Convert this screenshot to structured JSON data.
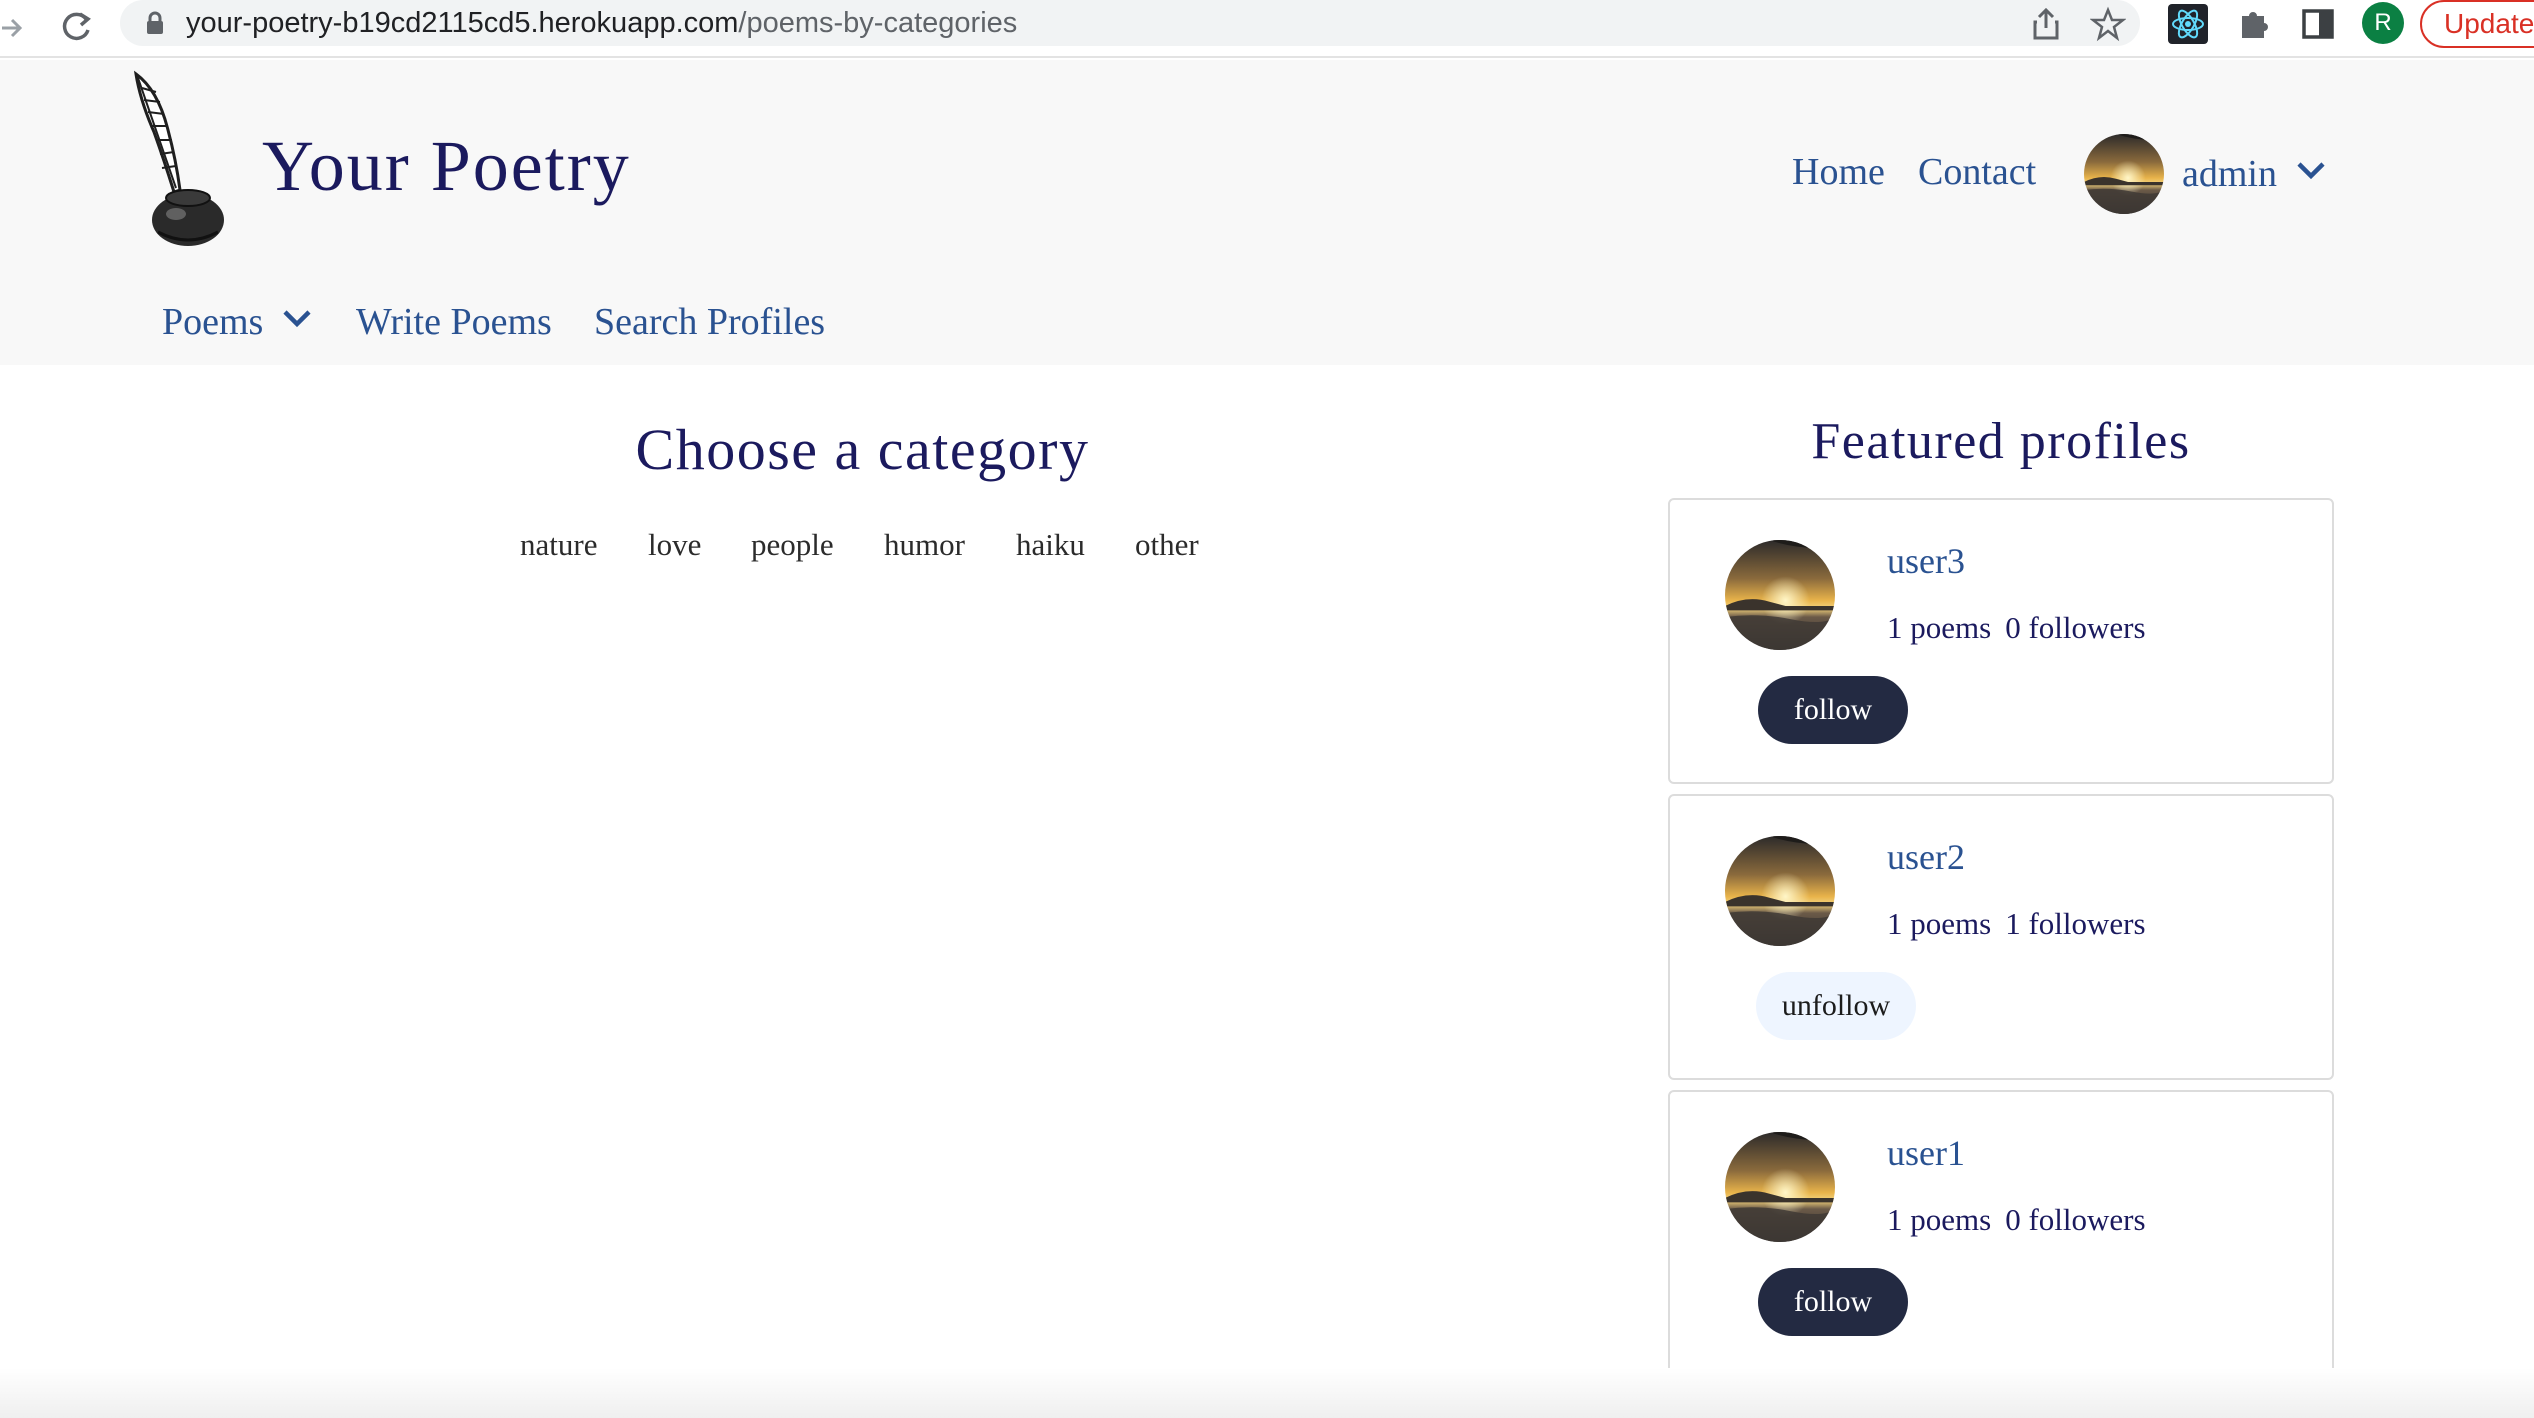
{
  "browser": {
    "url_host": "your-poetry-b19cd2115cd5.herokuapp.com",
    "url_path": "/poems-by-categories",
    "profile_initial": "R",
    "update_label": "Update"
  },
  "header": {
    "brand": "Your Poetry",
    "nav": {
      "home": "Home",
      "contact": "Contact"
    },
    "user": {
      "name": "admin"
    },
    "subnav": {
      "poems": "Poems",
      "write": "Write Poems",
      "search": "Search Profiles"
    }
  },
  "main": {
    "category_title": "Choose a category",
    "categories": [
      "nature",
      "love",
      "people",
      "humor",
      "haiku",
      "other"
    ]
  },
  "featured": {
    "title": "Featured profiles",
    "profiles": [
      {
        "username": "user3",
        "poems": "1 poems",
        "followers": "0 followers",
        "button": "follow"
      },
      {
        "username": "user2",
        "poems": "1 poems",
        "followers": "1 followers",
        "button": "unfollow"
      },
      {
        "username": "user1",
        "poems": "1 poems",
        "followers": "0 followers",
        "button": "follow"
      }
    ]
  },
  "colors": {
    "brand_navy": "#1b1a5e",
    "link_blue": "#2a5291",
    "follow_bg": "#232a42",
    "unfollow_bg": "#eef5ff",
    "header_bg": "#f8f8f8"
  },
  "icons": {
    "logo": "quill-inkwell-icon",
    "avatar": "sunset-photo-avatar",
    "dropdown": "chevron-down-icon"
  }
}
